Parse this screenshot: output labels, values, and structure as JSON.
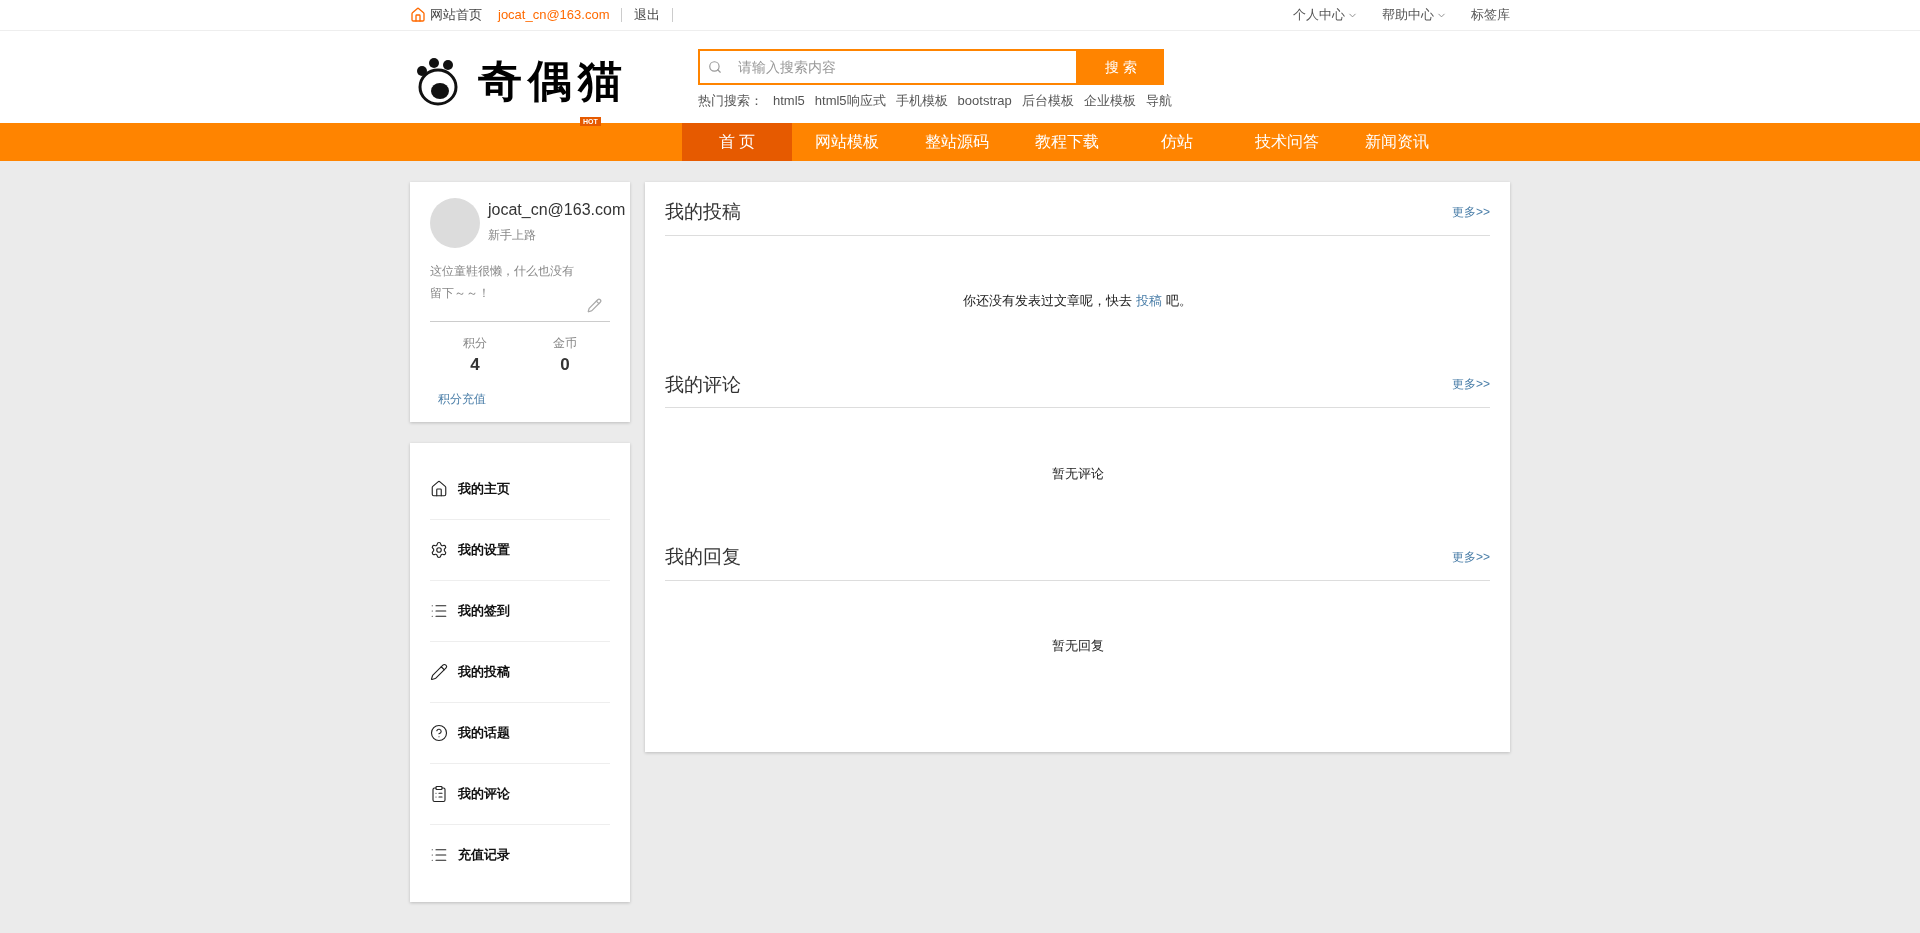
{
  "top_bar": {
    "home_link": "网站首页",
    "user_email": "jocat_cn@163.com",
    "logout": "退出",
    "right_links": [
      {
        "label": "个人中心",
        "has_dropdown": true
      },
      {
        "label": "帮助中心",
        "has_dropdown": true
      },
      {
        "label": "标签库",
        "has_dropdown": false
      }
    ]
  },
  "header": {
    "logo_text": "奇偶猫",
    "hot_badge": "HOT",
    "search": {
      "placeholder": "请输入搜索内容",
      "button": "搜 索"
    },
    "hot_search_label": "热门搜索：",
    "hot_searches": [
      "html5",
      "html5响应式",
      "手机模板",
      "bootstrap",
      "后台模板",
      "企业模板",
      "导航"
    ]
  },
  "nav": [
    {
      "label": "首 页",
      "selected": true
    },
    {
      "label": "网站模板",
      "selected": false
    },
    {
      "label": "整站源码",
      "selected": false
    },
    {
      "label": "教程下载",
      "selected": false
    },
    {
      "label": "仿站",
      "selected": false
    },
    {
      "label": "技术问答",
      "selected": false
    },
    {
      "label": "新闻资讯",
      "selected": false
    }
  ],
  "profile": {
    "username": "jocat_cn@163.com",
    "level": "新手上路",
    "bio": "这位童鞋很懒，什么也没有留下～～！",
    "stats": [
      {
        "label": "积分",
        "value": "4"
      },
      {
        "label": "金币",
        "value": "0"
      }
    ],
    "recharge_link": "积分充值"
  },
  "sidebar": {
    "items": [
      {
        "label": "我的主页",
        "kind": "home"
      },
      {
        "label": "我的设置",
        "kind": "settings"
      },
      {
        "label": "我的签到",
        "kind": "list"
      },
      {
        "label": "我的投稿",
        "kind": "pencil"
      },
      {
        "label": "我的话题",
        "kind": "question"
      },
      {
        "label": "我的评论",
        "kind": "clipboard"
      },
      {
        "label": "充值记录",
        "kind": "list"
      }
    ]
  },
  "sections": [
    {
      "title": "我的投稿",
      "more": "更多>>",
      "empty": {
        "before": "你还没有发表过文章呢，快去 ",
        "link": "投稿",
        "after": " 吧。"
      }
    },
    {
      "title": "我的评论",
      "more": "更多>>",
      "empty": {
        "before": "暂无评论"
      }
    },
    {
      "title": "我的回复",
      "more": "更多>>",
      "empty": {
        "before": "暂无回复"
      }
    }
  ]
}
